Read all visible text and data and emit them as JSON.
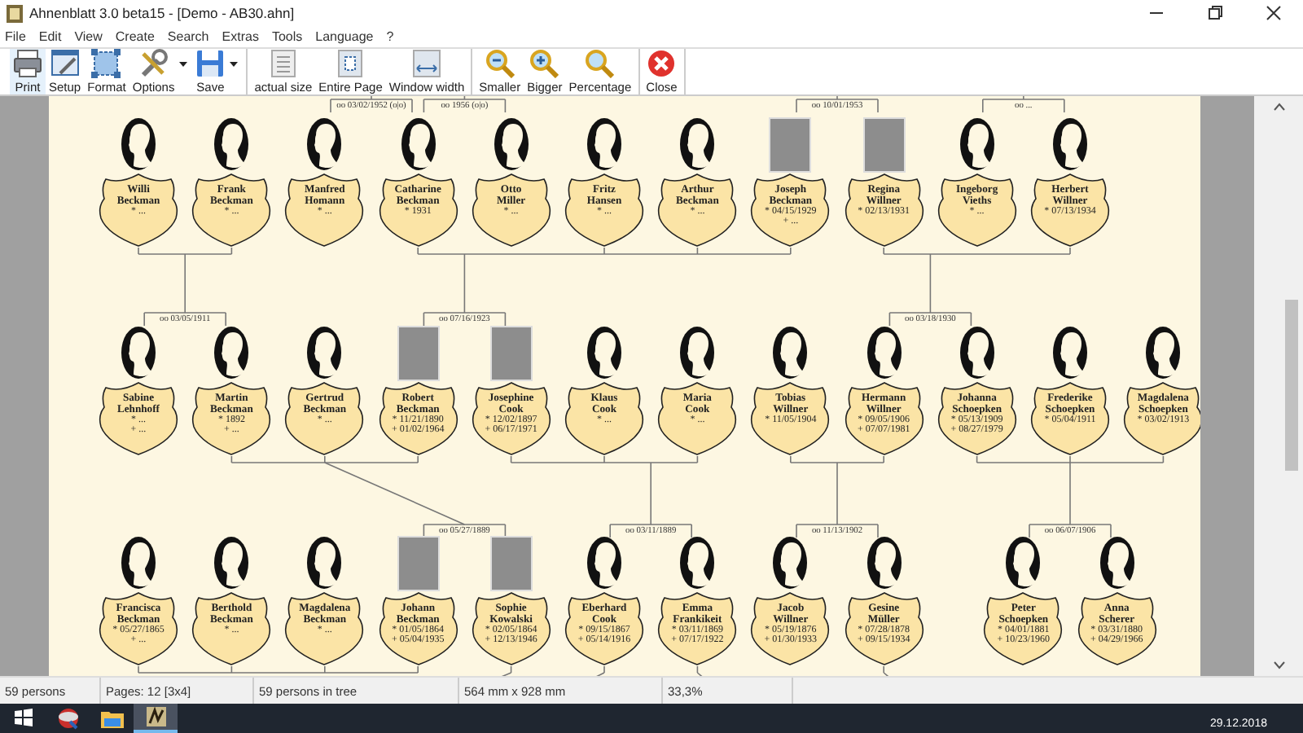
{
  "window": {
    "title": "Ahnenblatt 3.0 beta15 - [Demo - AB30.ahn]"
  },
  "menu": [
    "File",
    "Edit",
    "View",
    "Create",
    "Search",
    "Extras",
    "Tools",
    "Language",
    "?"
  ],
  "toolbar_groups": [
    [
      {
        "label": "Print",
        "dropdown": false,
        "hovered": true
      },
      {
        "label": "Setup",
        "dropdown": false,
        "hovered": false
      },
      {
        "label": "Format",
        "dropdown": false,
        "hovered": false
      },
      {
        "label": "Options",
        "dropdown": true,
        "hovered": false
      },
      {
        "label": "Save",
        "dropdown": true,
        "hovered": false
      }
    ],
    [
      {
        "label": "actual size",
        "dropdown": false,
        "hovered": false
      },
      {
        "label": "Entire Page",
        "dropdown": false,
        "hovered": false
      },
      {
        "label": "Window width",
        "dropdown": false,
        "hovered": false
      }
    ],
    [
      {
        "label": "Smaller",
        "dropdown": false,
        "hovered": false
      },
      {
        "label": "Bigger",
        "dropdown": false,
        "hovered": false
      },
      {
        "label": "Percentage",
        "dropdown": false,
        "hovered": false
      }
    ],
    [
      {
        "label": "Close",
        "dropdown": false,
        "hovered": false
      }
    ]
  ],
  "generations": [
    {
      "marriages": [
        "oo 03/02/1952 (o|o)",
        "oo 1956 (o|o)",
        "oo 10/01/1953",
        "oo ..."
      ],
      "persons": [
        {
          "name": "Willi Beckman",
          "dates": [
            "* ..."
          ],
          "kind": "silhouette"
        },
        {
          "name": "Frank Beckman",
          "dates": [
            "* ..."
          ],
          "kind": "silhouette"
        },
        {
          "name": "Manfred Homann",
          "dates": [
            "* ..."
          ],
          "kind": "silhouette"
        },
        {
          "name": "Catharine Beckman",
          "dates": [
            "* 1931"
          ],
          "kind": "silhouette"
        },
        {
          "name": "Otto Miller",
          "dates": [
            "* ..."
          ],
          "kind": "silhouette"
        },
        {
          "name": "Fritz Hansen",
          "dates": [
            "* ..."
          ],
          "kind": "silhouette"
        },
        {
          "name": "Arthur Beckman",
          "dates": [
            "* ..."
          ],
          "kind": "silhouette"
        },
        {
          "name": "Joseph Beckman",
          "dates": [
            "* 04/15/1929",
            "+ ..."
          ],
          "kind": "photo"
        },
        {
          "name": "Regina Willner",
          "dates": [
            "* 02/13/1931"
          ],
          "kind": "photo"
        },
        {
          "name": "Ingeborg Vieths",
          "dates": [
            "* ..."
          ],
          "kind": "silhouette"
        },
        {
          "name": "Herbert Willner",
          "dates": [
            "* 07/13/1934"
          ],
          "kind": "silhouette"
        }
      ]
    },
    {
      "marriages": [
        "oo 03/05/1911",
        "oo 07/16/1923",
        "oo 03/18/1930"
      ],
      "persons": [
        {
          "name": "Sabine Lehnhoff",
          "dates": [
            "* ...",
            "+ ..."
          ],
          "kind": "silhouette"
        },
        {
          "name": "Martin Beckman",
          "dates": [
            "* 1892",
            "+ ..."
          ],
          "kind": "silhouette"
        },
        {
          "name": "Gertrud Beckman",
          "dates": [
            "* ..."
          ],
          "kind": "silhouette"
        },
        {
          "name": "Robert Beckman",
          "dates": [
            "* 11/21/1890",
            "+ 01/02/1964"
          ],
          "kind": "photo"
        },
        {
          "name": "Josephine Cook",
          "dates": [
            "* 12/02/1897",
            "+ 06/17/1971"
          ],
          "kind": "photo"
        },
        {
          "name": "Klaus Cook",
          "dates": [
            "* ..."
          ],
          "kind": "silhouette"
        },
        {
          "name": "Maria Cook",
          "dates": [
            "* ..."
          ],
          "kind": "silhouette"
        },
        {
          "name": "Tobias Willner",
          "dates": [
            "* 11/05/1904"
          ],
          "kind": "silhouette"
        },
        {
          "name": "Hermann Willner",
          "dates": [
            "* 09/05/1906",
            "+ 07/07/1981"
          ],
          "kind": "silhouette"
        },
        {
          "name": "Johanna Schoepken",
          "dates": [
            "* 05/13/1909",
            "+ 08/27/1979"
          ],
          "kind": "silhouette"
        },
        {
          "name": "Frederike Schoepken",
          "dates": [
            "* 05/04/1911"
          ],
          "kind": "silhouette"
        },
        {
          "name": "Magdalena Schoepken",
          "dates": [
            "* 03/02/1913"
          ],
          "kind": "silhouette"
        }
      ]
    },
    {
      "marriages": [
        "oo 05/27/1889",
        "oo 03/11/1889",
        "oo 11/13/1902",
        "oo 06/07/1906"
      ],
      "persons": [
        {
          "name": "Francisca Beckman",
          "dates": [
            "* 05/27/1865",
            "+ ..."
          ],
          "kind": "silhouette"
        },
        {
          "name": "Berthold Beckman",
          "dates": [
            "* ..."
          ],
          "kind": "silhouette"
        },
        {
          "name": "Magdalena Beckman",
          "dates": [
            "* ..."
          ],
          "kind": "silhouette"
        },
        {
          "name": "Johann Beckman",
          "dates": [
            "* 01/05/1864",
            "+ 05/04/1935"
          ],
          "kind": "photo"
        },
        {
          "name": "Sophie Kowalski",
          "dates": [
            "* 02/05/1864",
            "+ 12/13/1946"
          ],
          "kind": "photo"
        },
        {
          "name": "Eberhard Cook",
          "dates": [
            "* 09/15/1867",
            "+ 05/14/1916"
          ],
          "kind": "silhouette"
        },
        {
          "name": "Emma Frankikeit",
          "dates": [
            "* 03/11/1869",
            "+ 07/17/1922"
          ],
          "kind": "silhouette"
        },
        {
          "name": "Jacob Willner",
          "dates": [
            "* 05/19/1876",
            "+ 01/30/1933"
          ],
          "kind": "silhouette"
        },
        {
          "name": "Gesine Müller",
          "dates": [
            "* 07/28/1878",
            "+ 09/15/1934"
          ],
          "kind": "silhouette"
        },
        {
          "name": "Peter Schoepken",
          "dates": [
            "* 04/01/1881",
            "+ 10/23/1960"
          ],
          "kind": "silhouette"
        },
        {
          "name": "Anna Scherer",
          "dates": [
            "* 03/31/1880",
            "+ 04/29/1966"
          ],
          "kind": "silhouette"
        }
      ]
    }
  ],
  "status_bar": [
    "59 persons",
    "Pages: 12 [3x4]",
    "59 persons in tree",
    "564 mm x 928 mm",
    "33,3%"
  ],
  "taskbar": {
    "apps": [
      {
        "selected": false
      },
      {
        "selected": false
      },
      {
        "selected": true
      }
    ],
    "clock": "29.12.2018"
  }
}
